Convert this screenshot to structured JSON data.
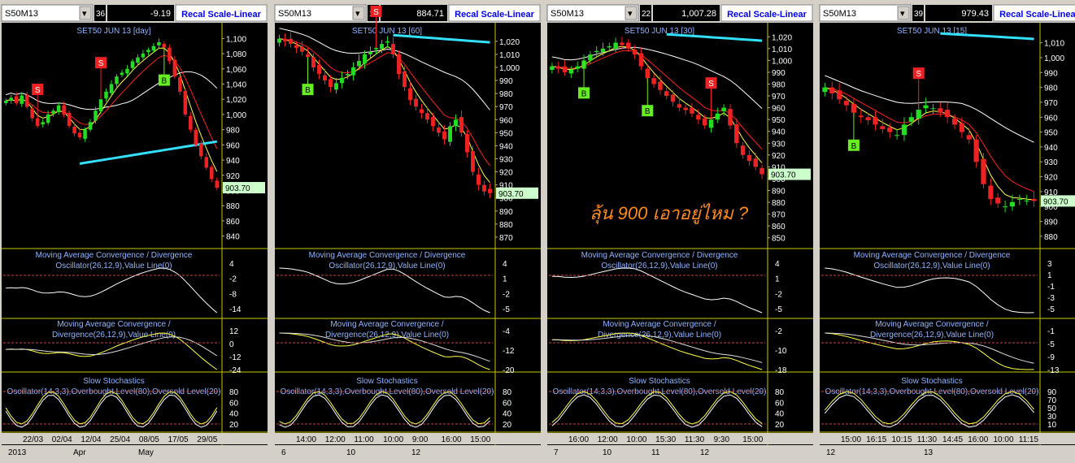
{
  "annotation": "ลุ้น 900 เอาอยู่ไหม ?",
  "colors": {
    "candle_up": "#22dd22",
    "candle_down": "#ee2222",
    "ma_fast": "#ffff44",
    "ma_white": "#ffffff",
    "ma_red": "#ff2020",
    "ma_cyan": "#33e0ff",
    "indicator_title": "#8fb4ff",
    "price_tag": "#ccffcc",
    "signal_buy": "#66ee22",
    "signal_sell": "#ee2222",
    "annotation": "#ff8c1a"
  },
  "panels": [
    {
      "symbol": "S50M13",
      "count": "36",
      "change": "-9.19",
      "recal": "Recal Scale-Linear",
      "title": "SET50 JUN 13   [day]",
      "price_tag": "903.70",
      "price_ticks": [
        "1,100",
        "1,080",
        "1,060",
        "1,040",
        "1,020",
        "1,000",
        "980",
        "960",
        "940",
        "920",
        "900",
        "880",
        "860",
        "840"
      ],
      "macd1_ticks": [
        "4",
        "-2",
        "-8",
        "-14"
      ],
      "macd2_ticks": [
        "12",
        "0",
        "-12",
        "-24"
      ],
      "stoch_ticks": [
        "80",
        "60",
        "40",
        "20"
      ],
      "time_labels": [
        "22/03",
        "02/04",
        "12/04",
        "25/04",
        "08/05",
        "17/05",
        "29/05"
      ],
      "date_labels": [
        "2013",
        "Apr",
        "May"
      ]
    },
    {
      "symbol": "S50M13",
      "count": "17",
      "change": "884.71",
      "recal": "Recal Scale-Linear",
      "title": "SET50 JUN 13   [60]",
      "price_tag": "903.70",
      "price_ticks": [
        "1,020",
        "1,010",
        "1,000",
        "990",
        "980",
        "970",
        "960",
        "950",
        "940",
        "930",
        "920",
        "910",
        "900",
        "890",
        "880",
        "870"
      ],
      "macd1_ticks": [
        "4",
        "1",
        "-2",
        "-5"
      ],
      "macd2_ticks": [
        "-4",
        "-12",
        "-20"
      ],
      "stoch_ticks": [
        "80",
        "60",
        "40",
        "20"
      ],
      "time_labels": [
        "14:00",
        "12:00",
        "11:00",
        "10:00",
        "9:00",
        "16:00",
        "15:00"
      ],
      "date_labels": [
        "6",
        "10",
        "12"
      ]
    },
    {
      "symbol": "S50M13",
      "count": "22",
      "change": "1,007.28",
      "recal": "Recal Scale-Linear",
      "title": "SET50 JUN 13   [30]",
      "price_tag": "903.70",
      "price_ticks": [
        "1,020",
        "1,010",
        "1,000",
        "990",
        "980",
        "970",
        "960",
        "950",
        "940",
        "930",
        "920",
        "910",
        "900",
        "890",
        "880",
        "870",
        "860",
        "850"
      ],
      "macd1_ticks": [
        "4",
        "1",
        "-2",
        "-5"
      ],
      "macd2_ticks": [
        "-2",
        "-10",
        "-18"
      ],
      "stoch_ticks": [
        "80",
        "60",
        "40",
        "20"
      ],
      "time_labels": [
        "16:00",
        "12:00",
        "10:00",
        "15:30",
        "11:30",
        "9:30",
        "15:00"
      ],
      "date_labels": [
        "7",
        "10",
        "11",
        "12"
      ]
    },
    {
      "symbol": "S50M13",
      "count": "39",
      "change": "979.43",
      "recal": "Recal Scale-Linear",
      "title": "SET50 JUN 13   [15]",
      "price_tag": "903.70",
      "price_ticks": [
        "1,010",
        "1,000",
        "990",
        "980",
        "970",
        "960",
        "950",
        "940",
        "930",
        "920",
        "910",
        "900",
        "890",
        "880"
      ],
      "macd1_ticks": [
        "3",
        "1",
        "-1",
        "-3",
        "-5"
      ],
      "macd2_ticks": [
        "-1",
        "-5",
        "-9",
        "-13"
      ],
      "stoch_ticks": [
        "90",
        "70",
        "50",
        "30",
        "10"
      ],
      "time_labels": [
        "15:00",
        "16:15",
        "10:15",
        "11:30",
        "14:45",
        "16:00",
        "10:00",
        "11:15"
      ],
      "date_labels": [
        "12",
        "13"
      ]
    }
  ],
  "indicators": {
    "macd_line": "Moving Average Convergence / Divergence Oscillator(26,12,9),Value Line(0)",
    "macd_hist": "Moving Average Convergence / Divergence(26,12,9),Value Line(0)",
    "stoch": "Slow Stochastics Oscillator(14,3,3),Overbought Level(80),Oversold Level(20)"
  },
  "signals": [
    {
      "panel": 0,
      "label": "S",
      "type": "sell"
    },
    {
      "panel": 0,
      "label": "S",
      "type": "sell"
    },
    {
      "panel": 0,
      "label": "B",
      "type": "buy"
    },
    {
      "panel": 1,
      "label": "B",
      "type": "buy"
    },
    {
      "panel": 1,
      "label": "S",
      "type": "sell"
    },
    {
      "panel": 2,
      "label": "B",
      "type": "buy"
    },
    {
      "panel": 2,
      "label": "B",
      "type": "buy"
    },
    {
      "panel": 2,
      "label": "S",
      "type": "sell"
    },
    {
      "panel": 3,
      "label": "B",
      "type": "buy"
    },
    {
      "panel": 3,
      "label": "S",
      "type": "sell"
    }
  ],
  "chart_data": [
    {
      "type": "candlestick",
      "title": "SET50 JUN 13 [day]",
      "ylim": [
        830,
        1110
      ],
      "close": [
        1018,
        1022,
        1015,
        1025,
        1010,
        995,
        985,
        990,
        1000,
        1005,
        1012,
        1000,
        985,
        975,
        970,
        980,
        990,
        1005,
        1020,
        1030,
        1040,
        1050,
        1055,
        1060,
        1070,
        1075,
        1080,
        1085,
        1090,
        1095,
        1088,
        1070,
        1050,
        1030,
        1000,
        980,
        960,
        945,
        930,
        915,
        903.7
      ]
    },
    {
      "type": "candlestick",
      "title": "SET50 JUN 13 [60]",
      "ylim": [
        865,
        1028
      ],
      "close": [
        1022,
        1020,
        1018,
        1015,
        1012,
        1008,
        1000,
        995,
        990,
        985,
        988,
        992,
        995,
        1000,
        1005,
        1010,
        1012,
        1015,
        1018,
        1020,
        1010,
        995,
        985,
        975,
        970,
        965,
        960,
        955,
        950,
        945,
        955,
        960,
        950,
        935,
        920,
        910,
        905,
        903.7
      ]
    },
    {
      "type": "candlestick",
      "title": "SET50 JUN 13 [30]",
      "ylim": [
        845,
        1025
      ],
      "close": [
        995,
        993,
        990,
        992,
        995,
        1000,
        1005,
        1008,
        1010,
        1012,
        1015,
        1013,
        1010,
        1005,
        995,
        985,
        980,
        975,
        970,
        965,
        960,
        958,
        955,
        950,
        945,
        950,
        955,
        960,
        945,
        930,
        920,
        915,
        910,
        903.7
      ]
    },
    {
      "type": "candlestick",
      "title": "SET50 JUN 13 [15]",
      "ylim": [
        875,
        1018
      ],
      "close": [
        980,
        976,
        972,
        968,
        963,
        960,
        958,
        955,
        952,
        950,
        948,
        955,
        960,
        965,
        968,
        966,
        963,
        960,
        955,
        950,
        945,
        930,
        915,
        905,
        902,
        900,
        903,
        905,
        904,
        903.7
      ]
    }
  ]
}
